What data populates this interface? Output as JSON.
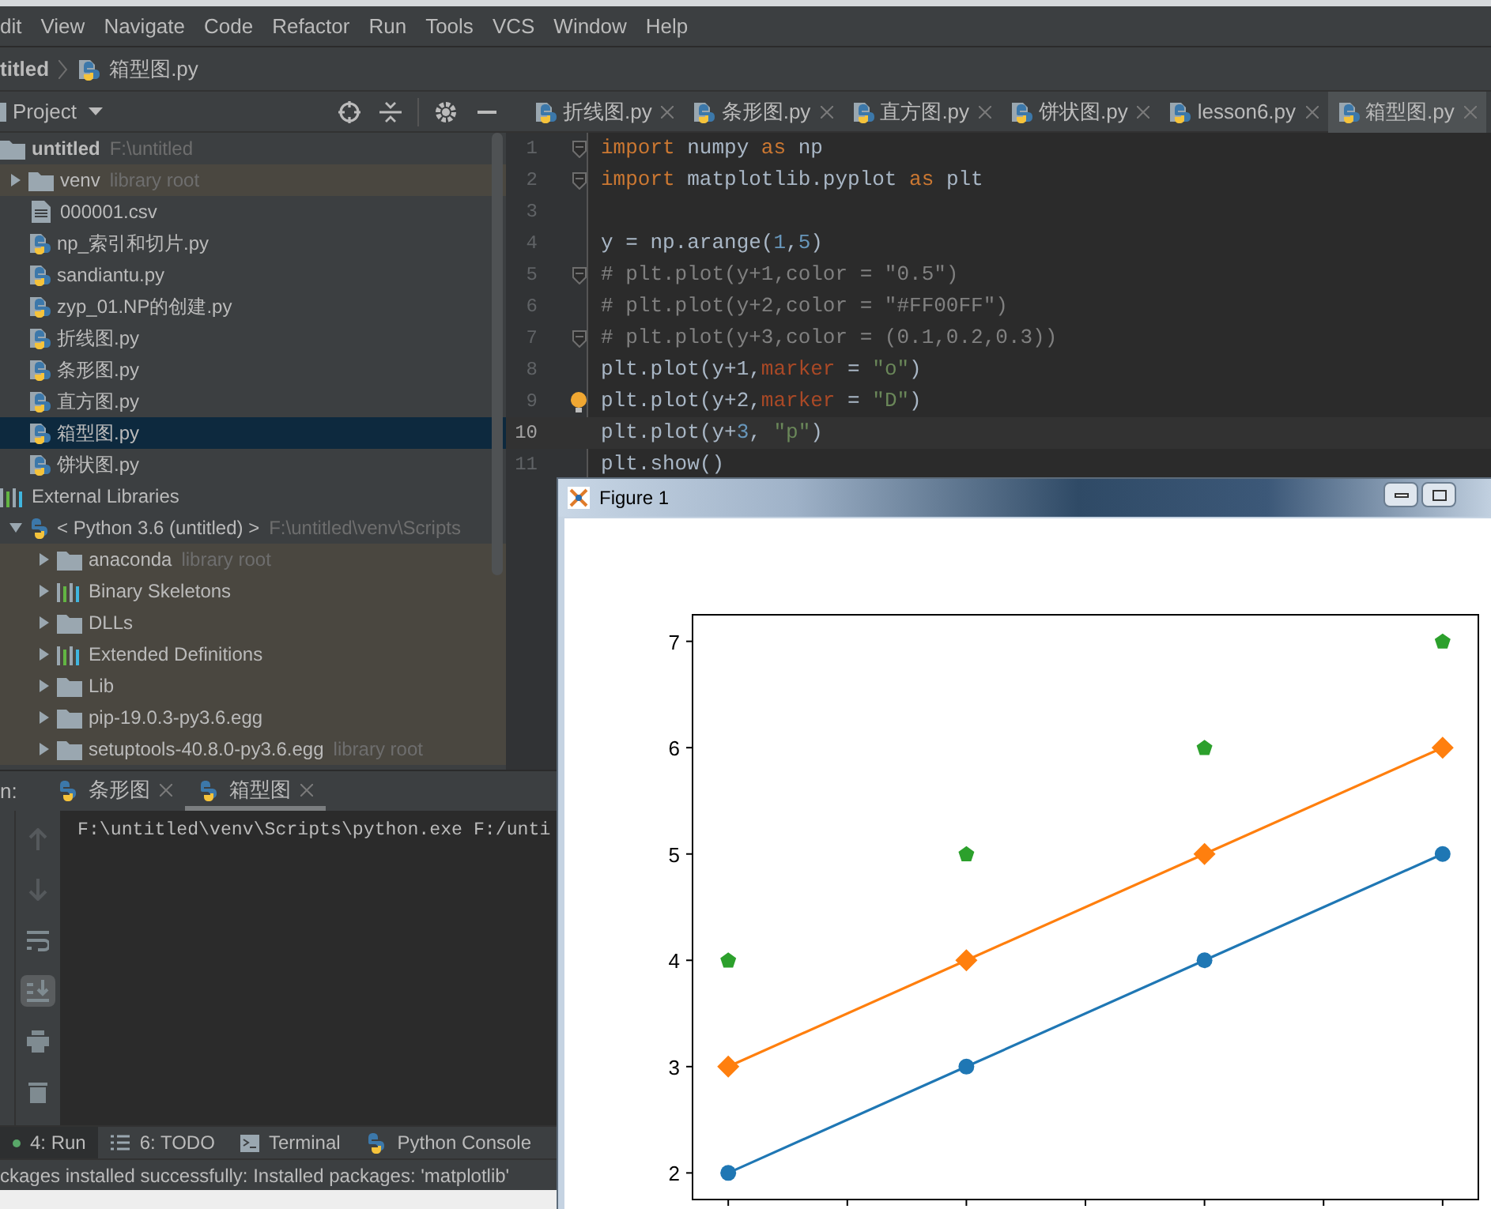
{
  "menu": [
    "dit",
    "View",
    "Navigate",
    "Code",
    "Refactor",
    "Run",
    "Tools",
    "VCS",
    "Window",
    "Help"
  ],
  "breadcrumb": {
    "project": "titled",
    "file": "箱型图.py"
  },
  "project_panel": {
    "title": "Project"
  },
  "editor_tabs": [
    {
      "label": "折线图.py",
      "selected": false
    },
    {
      "label": "条形图.py",
      "selected": false
    },
    {
      "label": "直方图.py",
      "selected": false
    },
    {
      "label": "饼状图.py",
      "selected": false
    },
    {
      "label": "lesson6.py",
      "selected": false
    },
    {
      "label": "箱型图.py",
      "selected": true
    }
  ],
  "tree": [
    {
      "label": "untitled",
      "hint": "F:\\untitled",
      "kind": "folder",
      "bold": true,
      "selected": false,
      "highlighted": false,
      "children": [
        {
          "label": "venv",
          "hint": "library root",
          "kind": "folder",
          "expanded": false,
          "selected": false,
          "highlighted": true
        },
        {
          "label": "000001.csv",
          "kind": "file",
          "selected": false,
          "highlighted": false
        },
        {
          "label": "np_索引和切片.py",
          "kind": "python",
          "selected": false,
          "highlighted": false
        },
        {
          "label": "sandiantu.py",
          "kind": "python",
          "selected": false,
          "highlighted": false
        },
        {
          "label": "zyp_01.NP的创建.py",
          "kind": "python",
          "selected": false,
          "highlighted": false
        },
        {
          "label": "折线图.py",
          "kind": "python",
          "selected": false,
          "highlighted": false
        },
        {
          "label": "条形图.py",
          "kind": "python",
          "selected": false,
          "highlighted": false
        },
        {
          "label": "直方图.py",
          "kind": "python",
          "selected": false,
          "highlighted": false
        },
        {
          "label": "箱型图.py",
          "kind": "python",
          "selected": true,
          "highlighted": false
        },
        {
          "label": "饼状图.py",
          "kind": "python",
          "selected": false,
          "highlighted": false
        }
      ]
    },
    {
      "label": "External Libraries",
      "kind": "libraries",
      "bold": false,
      "selected": false,
      "highlighted": false,
      "children": [
        {
          "label": "< Python 3.6 (untitled) >",
          "hint": "F:\\untitled\\venv\\Scripts",
          "kind": "sdk",
          "expanded": true,
          "selected": false,
          "highlighted": false,
          "children": [
            {
              "label": "anaconda",
              "hint": "library root",
              "kind": "folder",
              "expanded": false,
              "selected": false,
              "highlighted": true
            },
            {
              "label": "Binary Skeletons",
              "kind": "libraries",
              "expanded": false,
              "selected": false,
              "highlighted": true
            },
            {
              "label": "DLLs",
              "kind": "folder",
              "expanded": false,
              "selected": false,
              "highlighted": true
            },
            {
              "label": "Extended Definitions",
              "kind": "libraries",
              "expanded": false,
              "selected": false,
              "highlighted": true
            },
            {
              "label": "Lib",
              "kind": "folder",
              "expanded": false,
              "selected": false,
              "highlighted": true
            },
            {
              "label": "pip-19.0.3-py3.6.egg",
              "kind": "folder",
              "expanded": false,
              "selected": false,
              "highlighted": true
            },
            {
              "label": "setuptools-40.8.0-py3.6.egg",
              "hint": "library root",
              "kind": "folder",
              "expanded": false,
              "selected": false,
              "highlighted": true
            }
          ]
        }
      ]
    }
  ],
  "code": [
    {
      "number": "1",
      "fold": true,
      "current": false,
      "tokens": [
        {
          "text": "import",
          "kind": "kw"
        },
        {
          "text": " numpy ",
          "kind": "plain"
        },
        {
          "text": "as",
          "kind": "kw"
        },
        {
          "text": " np",
          "kind": "plain"
        }
      ]
    },
    {
      "number": "2",
      "fold": true,
      "current": false,
      "tokens": [
        {
          "text": "import",
          "kind": "kw"
        },
        {
          "text": " matplotlib.pyplot ",
          "kind": "plain"
        },
        {
          "text": "as",
          "kind": "kw"
        },
        {
          "text": " plt",
          "kind": "plain"
        }
      ]
    },
    {
      "number": "3",
      "fold": false,
      "current": false
    },
    {
      "number": "4",
      "fold": false,
      "current": false,
      "tokens": [
        {
          "text": "y = np.arange(",
          "kind": "plain"
        },
        {
          "text": "1",
          "kind": "num"
        },
        {
          "text": ",",
          "kind": "plain"
        },
        {
          "text": "5",
          "kind": "num"
        },
        {
          "text": ")",
          "kind": "plain"
        }
      ]
    },
    {
      "number": "5",
      "fold": true,
      "current": false,
      "tokens": [
        {
          "text": "# plt.plot(y+1,color = \"0.5\")",
          "kind": "comment"
        }
      ]
    },
    {
      "number": "6",
      "fold": false,
      "current": false,
      "tokens": [
        {
          "text": "# plt.plot(y+2,color = \"#FF00FF\")",
          "kind": "comment"
        }
      ]
    },
    {
      "number": "7",
      "fold": true,
      "current": false,
      "tokens": [
        {
          "text": "# plt.plot(y+3,color = (0.1,0.2,0.3))",
          "kind": "comment"
        }
      ]
    },
    {
      "number": "8",
      "fold": false,
      "current": false,
      "tokens": [
        {
          "text": "plt.plot(y+1,",
          "kind": "plain"
        },
        {
          "text": "marker",
          "kind": "param"
        },
        {
          "text": " = ",
          "kind": "plain"
        },
        {
          "text": "\"o\"",
          "kind": "str"
        },
        {
          "text": ")",
          "kind": "plain"
        }
      ]
    },
    {
      "number": "9",
      "fold": false,
      "current": false,
      "bulb": true,
      "tokens": [
        {
          "text": "plt.plot(y+2,",
          "kind": "plain"
        },
        {
          "text": "marker",
          "kind": "param"
        },
        {
          "text": " = ",
          "kind": "plain"
        },
        {
          "text": "\"D\"",
          "kind": "str"
        },
        {
          "text": ")",
          "kind": "plain"
        }
      ]
    },
    {
      "number": "10",
      "fold": false,
      "current": true,
      "tokens": [
        {
          "text": "plt.plot(y+",
          "kind": "plain"
        },
        {
          "text": "3",
          "kind": "num"
        },
        {
          "text": ", ",
          "kind": "plain"
        },
        {
          "text": "\"p\"",
          "kind": "str"
        },
        {
          "text": ")",
          "kind": "plain"
        }
      ]
    },
    {
      "number": "11",
      "fold": false,
      "current": false,
      "tokens": [
        {
          "text": "plt.show()",
          "kind": "plain"
        }
      ]
    }
  ],
  "run_panel": {
    "label": "n:",
    "tabs": [
      {
        "label": "条形图",
        "selected": false
      },
      {
        "label": "箱型图",
        "selected": true
      }
    ],
    "toolbar": [
      {
        "kind": "up",
        "selected": false
      },
      {
        "kind": "down",
        "selected": false
      },
      {
        "kind": "wrap",
        "selected": false
      },
      {
        "kind": "scroll-end",
        "selected": true
      },
      {
        "kind": "print",
        "selected": false
      },
      {
        "kind": "trash",
        "selected": false
      }
    ],
    "output": "F:\\untitled\\venv\\Scripts\\python.exe F:/unti"
  },
  "tool_tabs": [
    {
      "label": "4: Run",
      "kind": "run",
      "selected": true
    },
    {
      "label": "6: TODO",
      "kind": "list",
      "selected": false
    },
    {
      "label": "Terminal",
      "kind": "terminal",
      "selected": false
    },
    {
      "label": "Python Console",
      "kind": "python",
      "selected": false
    }
  ],
  "status_bar": "ckages installed successfully: Installed packages: 'matplotlib'",
  "figure_window": {
    "title": "Figure 1",
    "chart_data": {
      "type": "line",
      "categories": [
        null,
        null,
        null,
        null
      ],
      "ylim": [
        1.75,
        7.25
      ],
      "yticks": [
        2,
        3,
        4,
        5,
        6,
        7
      ],
      "series": [
        {
          "color": "#1f77b4",
          "marker": "circle",
          "type": "line",
          "values": [
            2,
            3,
            4,
            5
          ]
        },
        {
          "color": "#ff7f0e",
          "marker": "diamond",
          "type": "line",
          "values": [
            3,
            4,
            5,
            6
          ]
        },
        {
          "color": "#2ca02c",
          "type": "scatter",
          "values": [
            4,
            5,
            6,
            7
          ]
        }
      ]
    }
  }
}
